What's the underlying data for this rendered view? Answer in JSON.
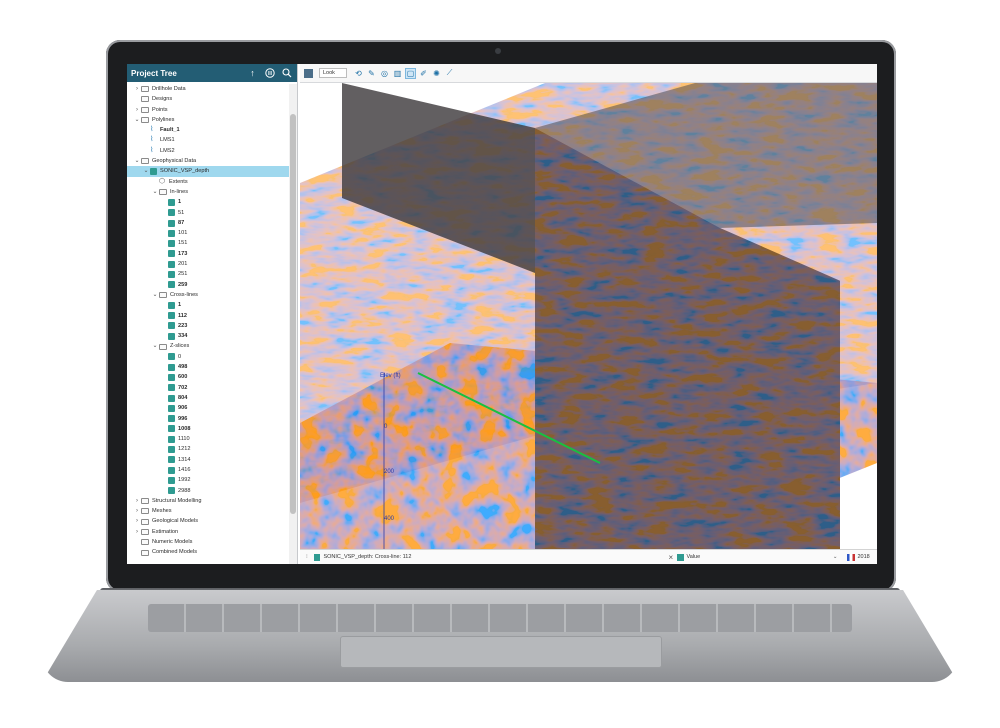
{
  "tree": {
    "title": "Project Tree",
    "header_icons": [
      "arrow-up-icon",
      "pause-icon",
      "search-icon"
    ],
    "items": [
      {
        "label": "Drillhole Data",
        "indent": 0,
        "chevron": ">",
        "icon": "folder"
      },
      {
        "label": "Designs",
        "indent": 0,
        "chevron": "",
        "icon": "folder"
      },
      {
        "label": "Points",
        "indent": 0,
        "chevron": ">",
        "icon": "folder"
      },
      {
        "label": "Polylines",
        "indent": 0,
        "chevron": "v",
        "icon": "folder"
      },
      {
        "label": "Fault_1",
        "indent": 1,
        "chevron": "",
        "icon": "polyline",
        "bold": true
      },
      {
        "label": "LMS1",
        "indent": 1,
        "chevron": "",
        "icon": "polyline"
      },
      {
        "label": "LMS2",
        "indent": 1,
        "chevron": "",
        "icon": "polyline"
      },
      {
        "label": "Geophysical Data",
        "indent": 0,
        "chevron": "v",
        "icon": "folder"
      },
      {
        "label": "SONIC_VSP_depth",
        "indent": 1,
        "chevron": "v",
        "icon": "seismic",
        "selected": true
      },
      {
        "label": "Extents",
        "indent": 2,
        "chevron": "",
        "icon": "extents"
      },
      {
        "label": "In-lines",
        "indent": 2,
        "chevron": "v",
        "icon": "folder"
      },
      {
        "label": "1",
        "indent": 3,
        "chevron": "",
        "icon": "seismic",
        "bold": true
      },
      {
        "label": "51",
        "indent": 3,
        "chevron": "",
        "icon": "seismic"
      },
      {
        "label": "87",
        "indent": 3,
        "chevron": "",
        "icon": "seismic",
        "bold": true
      },
      {
        "label": "101",
        "indent": 3,
        "chevron": "",
        "icon": "seismic"
      },
      {
        "label": "151",
        "indent": 3,
        "chevron": "",
        "icon": "seismic"
      },
      {
        "label": "173",
        "indent": 3,
        "chevron": "",
        "icon": "seismic",
        "bold": true
      },
      {
        "label": "201",
        "indent": 3,
        "chevron": "",
        "icon": "seismic"
      },
      {
        "label": "251",
        "indent": 3,
        "chevron": "",
        "icon": "seismic"
      },
      {
        "label": "259",
        "indent": 3,
        "chevron": "",
        "icon": "seismic",
        "bold": true
      },
      {
        "label": "Cross-lines",
        "indent": 2,
        "chevron": "v",
        "icon": "folder"
      },
      {
        "label": "1",
        "indent": 3,
        "chevron": "",
        "icon": "seismic",
        "bold": true
      },
      {
        "label": "112",
        "indent": 3,
        "chevron": "",
        "icon": "seismic",
        "bold": true
      },
      {
        "label": "223",
        "indent": 3,
        "chevron": "",
        "icon": "seismic",
        "bold": true
      },
      {
        "label": "334",
        "indent": 3,
        "chevron": "",
        "icon": "seismic",
        "bold": true
      },
      {
        "label": "Z-slices",
        "indent": 2,
        "chevron": "v",
        "icon": "folder"
      },
      {
        "label": "0",
        "indent": 3,
        "chevron": "",
        "icon": "seismic"
      },
      {
        "label": "498",
        "indent": 3,
        "chevron": "",
        "icon": "seismic",
        "bold": true
      },
      {
        "label": "600",
        "indent": 3,
        "chevron": "",
        "icon": "seismic",
        "bold": true
      },
      {
        "label": "702",
        "indent": 3,
        "chevron": "",
        "icon": "seismic",
        "bold": true
      },
      {
        "label": "804",
        "indent": 3,
        "chevron": "",
        "icon": "seismic",
        "bold": true
      },
      {
        "label": "906",
        "indent": 3,
        "chevron": "",
        "icon": "seismic",
        "bold": true
      },
      {
        "label": "996",
        "indent": 3,
        "chevron": "",
        "icon": "seismic",
        "bold": true
      },
      {
        "label": "1008",
        "indent": 3,
        "chevron": "",
        "icon": "seismic",
        "bold": true
      },
      {
        "label": "1110",
        "indent": 3,
        "chevron": "",
        "icon": "seismic"
      },
      {
        "label": "1212",
        "indent": 3,
        "chevron": "",
        "icon": "seismic"
      },
      {
        "label": "1314",
        "indent": 3,
        "chevron": "",
        "icon": "seismic"
      },
      {
        "label": "1416",
        "indent": 3,
        "chevron": "",
        "icon": "seismic"
      },
      {
        "label": "1992",
        "indent": 3,
        "chevron": "",
        "icon": "seismic"
      },
      {
        "label": "2988",
        "indent": 3,
        "chevron": "",
        "icon": "seismic"
      },
      {
        "label": "Structural Modelling",
        "indent": 0,
        "chevron": ">",
        "icon": "folder"
      },
      {
        "label": "Meshes",
        "indent": 0,
        "chevron": ">",
        "icon": "folder"
      },
      {
        "label": "Geological Models",
        "indent": 0,
        "chevron": ">",
        "icon": "folder"
      },
      {
        "label": "Estimation",
        "indent": 0,
        "chevron": ">",
        "icon": "folder"
      },
      {
        "label": "Numeric Models",
        "indent": 0,
        "chevron": "",
        "icon": "folder"
      },
      {
        "label": "Combined Models",
        "indent": 0,
        "chevron": "",
        "icon": "folder"
      }
    ]
  },
  "toolbar": {
    "look_label": "Look",
    "tools": [
      "rotate-icon",
      "draw-polyline-icon",
      "slice-icon",
      "plane-icon",
      "select-icon",
      "pencil-icon",
      "orbit-icon",
      "ruler-icon"
    ],
    "active_tool": 4
  },
  "scene": {
    "axis_labels": [
      "Elev (ft)",
      "0",
      "200",
      "400"
    ],
    "colors": {
      "positive": "#c4443c",
      "negative": "#3d4fb0",
      "panel_dark": "#3f3c3e",
      "line": "#18c040"
    }
  },
  "status": {
    "left_label": "SONIC_VSP_depth: Cross-line: 112",
    "right_label": "Value",
    "year": "2018"
  }
}
